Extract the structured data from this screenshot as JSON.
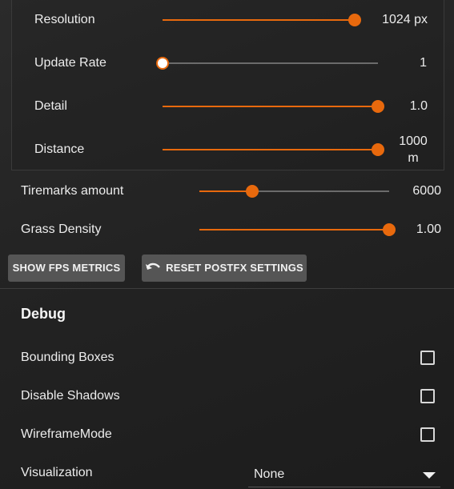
{
  "postfx": {
    "resolution": {
      "label": "Resolution",
      "value": "1024 px",
      "fraction": 0.98
    },
    "update_rate": {
      "label": "Update Rate",
      "value": "1",
      "fraction": 0.0
    },
    "detail": {
      "label": "Detail",
      "value": "1.0",
      "fraction": 1.0
    },
    "distance": {
      "label": "Distance",
      "value_line1": "1000",
      "value_line2": "m",
      "fraction": 1.0
    }
  },
  "tiremarks": {
    "label": "Tiremarks amount",
    "value": "6000",
    "fraction": 0.28
  },
  "grass": {
    "label": "Grass Density",
    "value": "1.00",
    "fraction": 1.0
  },
  "buttons": {
    "show_fps": "SHOW FPS METRICS",
    "reset_postfx": "RESET POSTFX SETTINGS"
  },
  "debug": {
    "title": "Debug",
    "bounding_boxes": {
      "label": "Bounding Boxes",
      "checked": false
    },
    "disable_shadows": {
      "label": "Disable Shadows",
      "checked": false
    },
    "wireframe": {
      "label": "WireframeMode",
      "checked": false
    },
    "visualization": {
      "label": "Visualization",
      "value": "None"
    }
  },
  "colors": {
    "accent": "#e8690d",
    "track": "#6b6b6b",
    "button": "#555555"
  },
  "icons": {
    "reset": "undo-arrow-icon",
    "dropdown": "caret-down-icon"
  }
}
